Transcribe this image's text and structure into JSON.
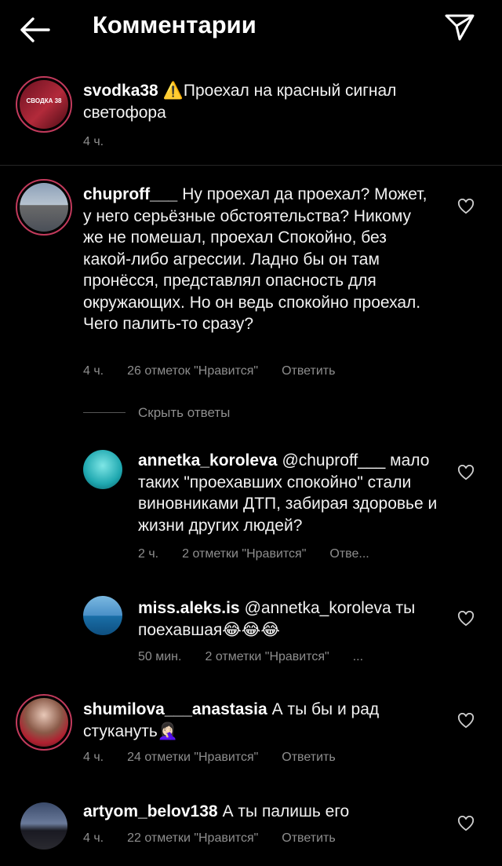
{
  "header": {
    "title": "Комментарии"
  },
  "caption": {
    "username": "svodka38",
    "emoji": "⚠️",
    "text": "Проехал на красный сигнал светофора",
    "time": "4 ч.",
    "avatar_text": "СВОДКА 38"
  },
  "comments": [
    {
      "username": "chuproff___",
      "text": "Ну проехал да проехал? Может, у него серьёзные обстоятельства? Никому же не помешал, проехал Спокойно, без какой-либо агрессии. Ладно бы он там пронёсся, представлял опасность для окружающих. Но он ведь спокойно проехал. Чего палить-то сразу?",
      "time": "4 ч.",
      "likes": "26 отметок \"Нравится\"",
      "reply": "Ответить"
    },
    {
      "username": "shumilova___anastasia",
      "text": "А ты бы и рад стукануть🤦🏻‍♀️",
      "time": "4 ч.",
      "likes": "24 отметки \"Нравится\"",
      "reply": "Ответить"
    },
    {
      "username": "artyom_belov138",
      "text": "А ты палишь его",
      "time": "4 ч.",
      "likes": "22 отметки \"Нравится\"",
      "reply": "Ответить"
    }
  ],
  "hide_replies": "Скрыть ответы",
  "replies": [
    {
      "username": "annetka_koroleva",
      "text": "@chuproff___ мало таких \"проехавших спокойно\" стали виновниками ДТП, забирая здоровье и жизни других людей?",
      "time": "2 ч.",
      "likes": "2 отметки \"Нравится\"",
      "reply": "Отве..."
    },
    {
      "username": "miss.aleks.is",
      "text": "@annetka_koroleva ты поехавшая😂😂😂",
      "time": "50 мин.",
      "likes": "2 отметки \"Нравится\"",
      "reply": "..."
    }
  ],
  "colors": {
    "background": "#000000",
    "meta": "#8e8e8e",
    "ring": "#c23a5c"
  }
}
